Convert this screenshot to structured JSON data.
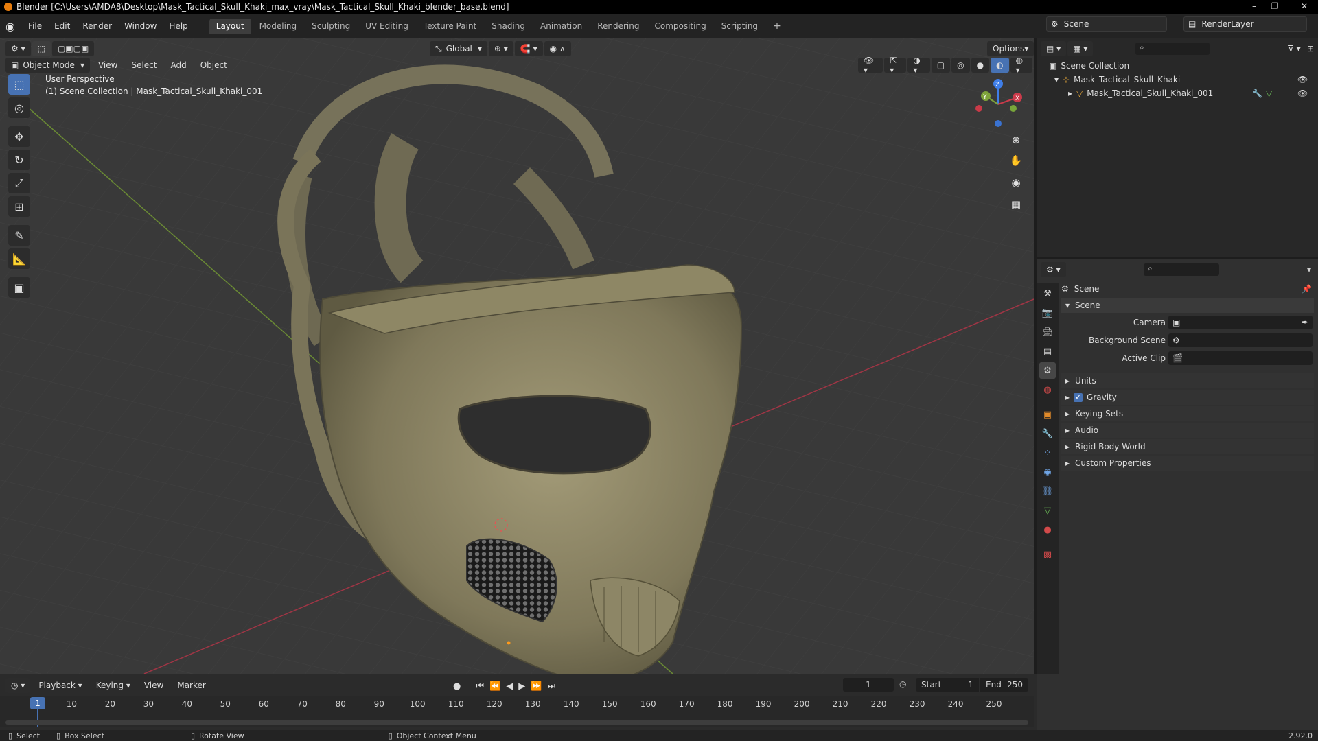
{
  "window": {
    "title": "Blender [C:\\Users\\AMDA8\\Desktop\\Mask_Tactical_Skull_Khaki_max_vray\\Mask_Tactical_Skull_Khaki_blender_base.blend]"
  },
  "menu": [
    "File",
    "Edit",
    "Render",
    "Window",
    "Help"
  ],
  "workspaces": [
    "Layout",
    "Modeling",
    "Sculpting",
    "UV Editing",
    "Texture Paint",
    "Shading",
    "Animation",
    "Rendering",
    "Compositing",
    "Scripting"
  ],
  "active_workspace": "Layout",
  "scene_selector": "Scene",
  "view_layer": "RenderLayer",
  "viewport": {
    "transform_orientation": "Global",
    "options_label": "Options",
    "mode": "Object Mode",
    "menus": [
      "View",
      "Select",
      "Add",
      "Object"
    ],
    "perspective_label": "User Perspective",
    "collection_info": "(1) Scene Collection | Mask_Tactical_Skull_Khaki_001",
    "gizmo": {
      "x": "X",
      "y": "Y",
      "z": "Z"
    }
  },
  "outliner": {
    "root": "Scene Collection",
    "collection": "Mask_Tactical_Skull_Khaki",
    "object": "Mask_Tactical_Skull_Khaki_001"
  },
  "properties": {
    "context_title": "Scene",
    "panel_title": "Scene",
    "fields": [
      {
        "label": "Camera",
        "value": ""
      },
      {
        "label": "Background Scene",
        "value": ""
      },
      {
        "label": "Active Clip",
        "value": ""
      }
    ],
    "subpanels": [
      "Units",
      "Gravity",
      "Keying Sets",
      "Audio",
      "Rigid Body World",
      "Custom Properties"
    ],
    "gravity_checked": true
  },
  "timeline": {
    "menus": [
      "Playback",
      "Keying",
      "View",
      "Marker"
    ],
    "current_frame": "1",
    "start_label": "Start",
    "start": "1",
    "end_label": "End",
    "end": "250",
    "ticks": [
      "1",
      "10",
      "20",
      "30",
      "40",
      "50",
      "60",
      "70",
      "80",
      "90",
      "100",
      "110",
      "120",
      "130",
      "140",
      "150",
      "160",
      "170",
      "180",
      "190",
      "200",
      "210",
      "220",
      "230",
      "240",
      "250"
    ]
  },
  "statusbar": {
    "select": "Select",
    "box_select": "Box Select",
    "rotate_view": "Rotate View",
    "context_menu": "Object Context Menu",
    "version": "2.92.0"
  },
  "colors": {
    "accent": "#4772b3",
    "x_axis": "#cc3b4b",
    "y_axis": "#7ea33a",
    "z_axis": "#3f7ee8",
    "mask": "#8b8362"
  }
}
